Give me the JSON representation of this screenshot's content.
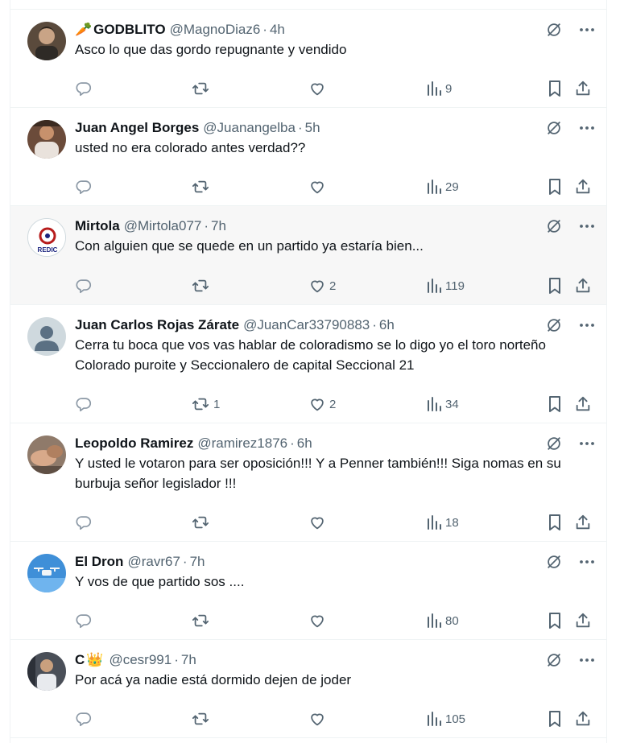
{
  "tweets": [
    {
      "emoji": "🥕",
      "name": "GODBLITO",
      "handle": "@MagnoDiaz6",
      "time": "4h",
      "text": "Asco lo que das gordo repugnante y vendido",
      "reply_count": "",
      "retweet_count": "",
      "like_count": "",
      "views": "9",
      "avatar_color": "#5a4a3c"
    },
    {
      "emoji": "",
      "name": "Juan Angel Borges",
      "handle": "@Juanangelba",
      "time": "5h",
      "text": "usted no era colorado antes verdad??",
      "reply_count": "",
      "retweet_count": "",
      "like_count": "",
      "views": "29",
      "avatar_color": "#6b4b3a"
    },
    {
      "emoji": "",
      "name": "Mirtola",
      "handle": "@Mirtola077",
      "time": "7h",
      "text": "Con alguien que se quede en un partido ya estaría bien...",
      "reply_count": "",
      "retweet_count": "",
      "like_count": "2",
      "views": "119",
      "avatar_color": "#b71c1c",
      "avatar_text": "REDIC"
    },
    {
      "emoji": "",
      "name": "Juan Carlos Rojas Zárate",
      "handle": "@JuanCar33790883",
      "time": "6h",
      "text": "Cerra tu boca que vos vas hablar de coloradismo se lo digo yo el toro norteño Colorado puroite y Seccionalero de capital Seccional 21",
      "reply_count": "",
      "retweet_count": "1",
      "like_count": "2",
      "views": "34",
      "avatar_color": "#cfd9de"
    },
    {
      "emoji": "",
      "name": "Leopoldo Ramirez",
      "handle": "@ramirez1876",
      "time": "6h",
      "text": "Y usted le votaron para ser oposición!!! Y a Penner también!!! Siga nomas en su burbuja señor legislador !!!",
      "reply_count": "",
      "retweet_count": "",
      "like_count": "",
      "views": "18",
      "avatar_color": "#8f7a6a"
    },
    {
      "emoji": "",
      "name": "El Dron",
      "handle": "@ravr67",
      "time": "7h",
      "text": "Y vos de que partido sos ....",
      "reply_count": "",
      "retweet_count": "",
      "like_count": "",
      "views": "80",
      "avatar_color": "#3f8fd8"
    },
    {
      "emoji": "👑",
      "name": "C",
      "handle": "@cesr991",
      "time": "7h",
      "text": "Por acá ya nadie está dormido dejen de joder",
      "reply_count": "",
      "retweet_count": "",
      "like_count": "",
      "views": "105",
      "avatar_color": "#4a4f58"
    }
  ]
}
